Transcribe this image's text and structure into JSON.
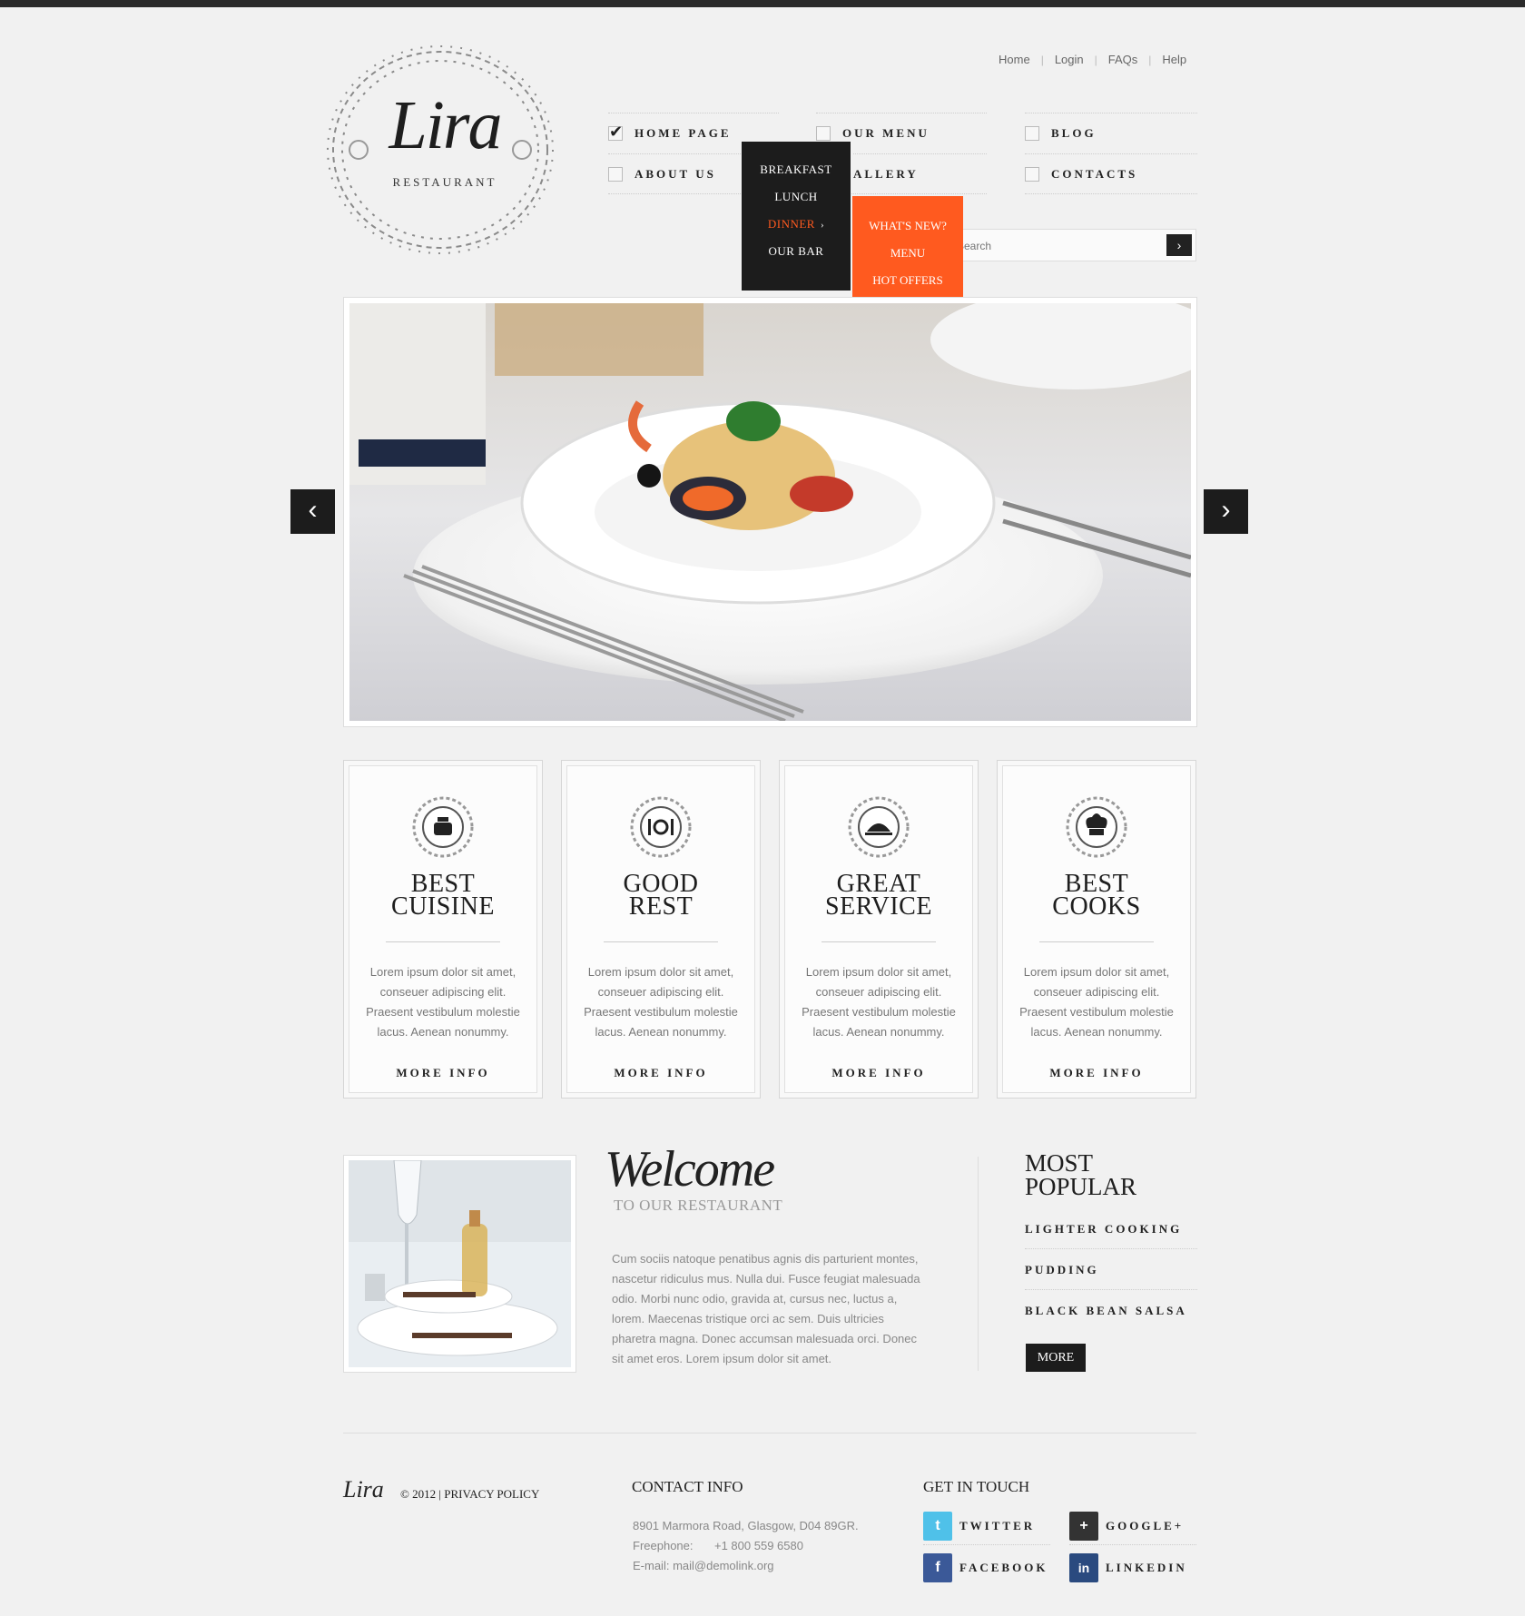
{
  "brand": {
    "name": "Lira",
    "subtitle": "RESTAURANT"
  },
  "top_links": [
    "Home",
    "Login",
    "FAQs",
    "Help"
  ],
  "nav": {
    "items": [
      {
        "label": "HOME PAGE",
        "checked": true
      },
      {
        "label": "OUR MENU",
        "checked": false
      },
      {
        "label": "BLOG",
        "checked": false
      },
      {
        "label": "ABOUT US",
        "checked": false
      },
      {
        "label": "ALLERY",
        "checked": false
      },
      {
        "label": "CONTACTS",
        "checked": false
      }
    ],
    "dropdown_menu": [
      "BREAKFAST",
      "LUNCH",
      "DINNER",
      "OUR BAR"
    ],
    "dropdown_active": "DINNER",
    "submenu": [
      "WHAT'S NEW?",
      "MENU",
      "HOT OFFERS"
    ]
  },
  "search": {
    "placeholder": "Search"
  },
  "slider": {
    "prev_icon": "chevron-left-icon",
    "next_icon": "chevron-right-icon"
  },
  "features": [
    {
      "title_1": "BEST",
      "title_2": "CUISINE",
      "icon": "cooking-pot-icon",
      "text": "Lorem ipsum dolor sit amet, conseuer adipiscing elit. Praesent vestibulum molestie lacus. Aenean nonummy.",
      "more": "MORE INFO"
    },
    {
      "title_1": "GOOD",
      "title_2": "REST",
      "icon": "cutlery-icon",
      "text": "Lorem ipsum dolor sit amet, conseuer adipiscing elit. Praesent vestibulum molestie lacus. Aenean nonummy.",
      "more": "MORE INFO"
    },
    {
      "title_1": "GREAT",
      "title_2": "SERVICE",
      "icon": "serving-tray-icon",
      "text": "Lorem ipsum dolor sit amet, conseuer adipiscing elit. Praesent vestibulum molestie lacus. Aenean nonummy.",
      "more": "MORE INFO"
    },
    {
      "title_1": "BEST",
      "title_2": "COOKS",
      "icon": "chef-hat-icon",
      "text": "Lorem ipsum dolor sit amet, conseuer adipiscing elit. Praesent vestibulum molestie lacus. Aenean nonummy.",
      "more": "MORE INFO"
    }
  ],
  "welcome": {
    "title": "Welcome",
    "subtitle": "TO OUR RESTAURANT",
    "text": "Cum sociis natoque penatibus agnis dis parturient montes, nascetur ridiculus mus. Nulla dui. Fusce feugiat malesuada odio. Morbi nunc odio, gravida at, cursus nec, luctus a, lorem. Maecenas tristique orci ac sem. Duis ultricies pharetra magna. Donec accumsan malesuada orci. Donec sit amet eros. Lorem ipsum dolor sit amet."
  },
  "popular": {
    "title_1": "MOST",
    "title_2": "POPULAR",
    "items": [
      "LIGHTER COOKING",
      "PUDDING",
      "BLACK BEAN SALSA"
    ],
    "more": "MORE"
  },
  "footer": {
    "logo": "Lira",
    "copyright": "© 2012",
    "privacy": "PRIVACY POLICY",
    "contact_title": "CONTACT INFO",
    "address": "8901 Marmora Road, Glasgow, D04 89GR.",
    "phone_label": "Freephone:",
    "phone": "+1 800 559 6580",
    "email_label": "E-mail:",
    "email": "mail@demolink.org",
    "social_title": "GET IN TOUCH",
    "social": [
      {
        "label": "TWITTER",
        "icon": "twitter-icon",
        "color": "#4fc1e9"
      },
      {
        "label": "GOOGLE+",
        "icon": "google-plus-icon",
        "color": "#333333"
      },
      {
        "label": "FACEBOOK",
        "icon": "facebook-icon",
        "color": "#3b5998"
      },
      {
        "label": "LINKEDIN",
        "icon": "linkedin-icon",
        "color": "#2a4a7f"
      }
    ]
  },
  "colors": {
    "accent": "#ff5a1f",
    "dark": "#1c1c1c"
  }
}
